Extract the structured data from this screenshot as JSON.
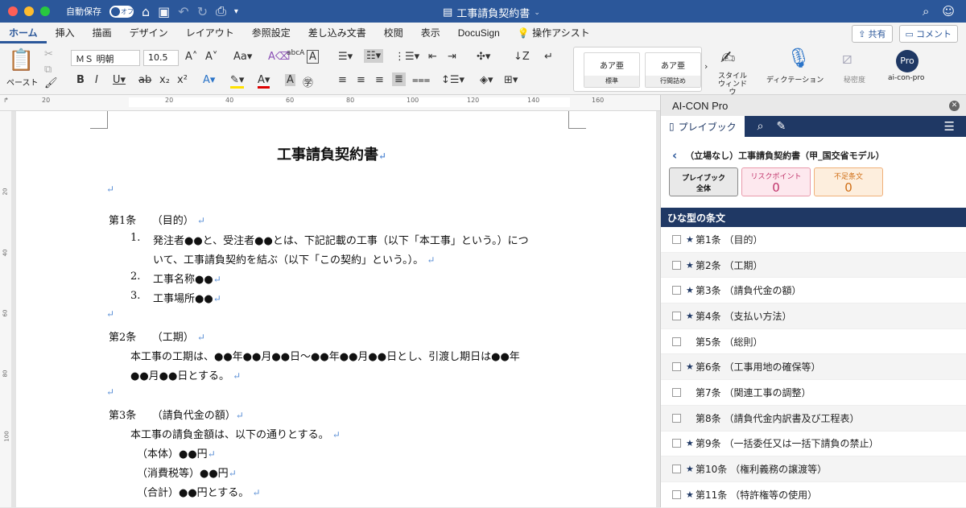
{
  "titlebar": {
    "autosave": "自動保存",
    "autosave_state": "オフ",
    "doc_title": "工事請負契約書"
  },
  "menu": {
    "tabs": [
      "ホーム",
      "挿入",
      "描画",
      "デザイン",
      "レイアウト",
      "参照設定",
      "差し込み文書",
      "校閲",
      "表示",
      "DocuSign",
      "操作アシスト"
    ],
    "share": "共有",
    "comment": "コメント"
  },
  "ribbon": {
    "paste": "ペースト",
    "font_name": "ＭＳ 明朝",
    "font_size": "10.5",
    "style1": "あア亜",
    "style1_label": "標準",
    "style2": "あア亜",
    "style2_label": "行間詰め",
    "style_window": "スタイル\nウィンドウ",
    "dictation": "ディクテーション",
    "sensitivity": "秘密度",
    "addin_icon": "Pro",
    "addin_label": "ai-con-pro"
  },
  "ruler": {
    "h": [
      "20",
      "20",
      "40",
      "60",
      "80",
      "100",
      "120",
      "140",
      "160"
    ],
    "v": [
      "20",
      "40",
      "60",
      "80",
      "100"
    ]
  },
  "document": {
    "title": "工事請負契約書",
    "a1_head": "第1条　　（目的）",
    "a1_1a": "発注者●●と、受注者●●とは、下記記載の工事（以下「本工事」という。）につ",
    "a1_1b": "いて、工事請負契約を結ぶ（以下「この契約」という。）。",
    "a1_2": "工事名称●●",
    "a1_3": "工事場所●●",
    "a2_head": "第2条　　（工期）",
    "a2_a": "本工事の工期は、●●年●●月●●日～●●年●●月●●日とし、引渡し期日は●●年",
    "a2_b": "●●月●●日とする。",
    "a3_head": "第3条　　（請負代金の額）",
    "a3_a": "本工事の請負金額は、以下の通りとする。",
    "a3_b": "（本体）●●円",
    "a3_c": "（消費税等）●●円",
    "a3_d": "（合計）●●円とする。"
  },
  "pane": {
    "title": "AI-CON Pro",
    "tab": "プレイブック",
    "back_title": "（立場なし）工事請負契約書（甲_国交省モデル）",
    "card1": "プレイブック\n全体",
    "card2_label": "リスクポイント",
    "card2_value": "0",
    "card3_label": "不足条文",
    "card3_value": "0",
    "section": "ひな型の条文",
    "items": [
      {
        "star": "★",
        "label": "第1条 （目的）"
      },
      {
        "star": "★",
        "label": "第2条 （工期）"
      },
      {
        "star": "★",
        "label": "第3条 （請負代金の額）"
      },
      {
        "star": "★",
        "label": "第4条 （支払い方法）"
      },
      {
        "star": "",
        "label": "第5条 （総則）"
      },
      {
        "star": "★",
        "label": "第6条 （工事用地の確保等）"
      },
      {
        "star": "",
        "label": "第7条 （関連工事の調整）"
      },
      {
        "star": "",
        "label": "第8条 （請負代金内訳書及び工程表）"
      },
      {
        "star": "★",
        "label": "第9条 （一括委任又は一括下請負の禁止）"
      },
      {
        "star": "★",
        "label": "第10条 （権利義務の譲渡等）"
      },
      {
        "star": "★",
        "label": "第11条 （特許権等の使用）"
      }
    ]
  }
}
